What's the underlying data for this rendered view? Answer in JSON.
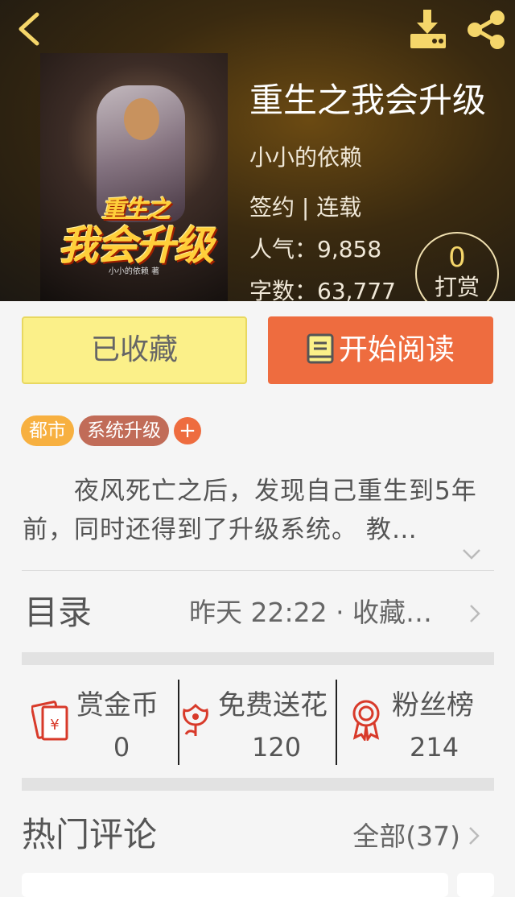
{
  "header": {
    "back_icon": "chevron-left-icon",
    "download_icon": "download-icon",
    "share_icon": "share-icon"
  },
  "book": {
    "title": "重生之我会升级",
    "author": "小小的依赖",
    "status": "签约 | 连载",
    "popularity": "人气：9,858",
    "word_count": "字数：63,777",
    "cover": {
      "title_small": "重生之",
      "title_large": "我会升级",
      "author_line": "小小的依赖 著"
    }
  },
  "tip": {
    "count": "0",
    "label": "打赏"
  },
  "actions": {
    "collected_label": "已收藏",
    "read_label": "开始阅读"
  },
  "tags": [
    {
      "label": "都市",
      "color": "#f7b040"
    },
    {
      "label": "系统升级",
      "color": "#c16c58"
    }
  ],
  "add_tag_label": "+",
  "synopsis": "夜风死亡之后，发现自己重生到5年前，同时还得到了升级系统。 教…",
  "catalog": {
    "title": "目录",
    "info": "昨天 22:22 · 收藏…"
  },
  "stats": [
    {
      "label": "赏金币",
      "value": "0",
      "icon": "red-envelope-icon"
    },
    {
      "label": "免费送花",
      "value": "120",
      "icon": "flower-icon"
    },
    {
      "label": "粉丝榜",
      "value": "214",
      "icon": "medal-icon"
    }
  ],
  "comments": {
    "title": "热门评论",
    "all_label": "全部(37)"
  },
  "colors": {
    "accent": "#ee6c3f",
    "collected_bg": "#fbf089",
    "tip_gold": "#f5d66a"
  }
}
